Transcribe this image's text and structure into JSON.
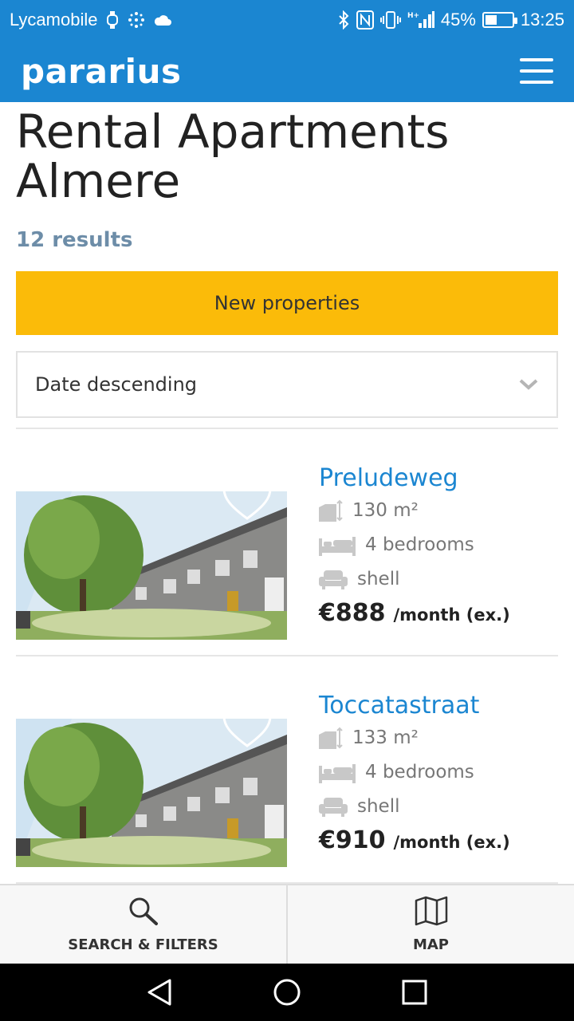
{
  "status_bar": {
    "carrier": "Lycamobile",
    "battery_text": "45%",
    "battery_level": 0.45,
    "time": "13:25",
    "network_label": "H+"
  },
  "header": {
    "logo": "pararius"
  },
  "page": {
    "title": "Rental Apartments Almere",
    "results": "12 results",
    "new_properties_label": "New properties",
    "sort_value": "Date descending"
  },
  "listings": [
    {
      "title": "Preludeweg",
      "area": "130 m²",
      "bedrooms": "4 bedrooms",
      "interior": "shell",
      "price": "€888",
      "price_suffix": "/month (ex.)"
    },
    {
      "title": "Toccatastraat",
      "area": "133 m²",
      "bedrooms": "4 bedrooms",
      "interior": "shell",
      "price": "€910",
      "price_suffix": "/month (ex.)"
    }
  ],
  "bottom_bar": {
    "search_label": "SEARCH & FILTERS",
    "map_label": "MAP"
  },
  "colors": {
    "brand_blue": "#1b86d1",
    "accent_yellow": "#fbbb09"
  },
  "icons": {
    "area": "area-icon",
    "bed": "bed-icon",
    "sofa": "sofa-icon",
    "heart": "heart-icon",
    "search": "search-icon",
    "map": "map-icon"
  }
}
